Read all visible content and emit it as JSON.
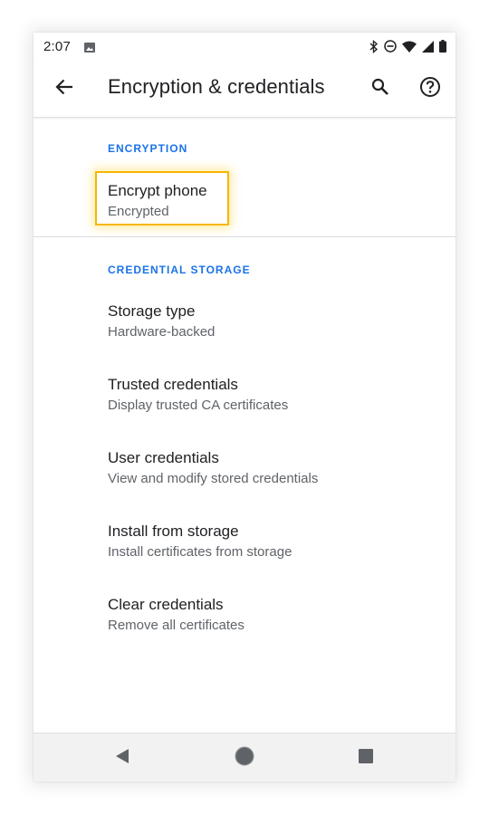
{
  "status_bar": {
    "time": "2:07",
    "icons": [
      "image-icon",
      "bluetooth-icon",
      "do-not-disturb-icon",
      "wifi-icon",
      "signal-icon",
      "battery-icon"
    ]
  },
  "app_bar": {
    "title": "Encryption & credentials",
    "back_icon": "arrow-back-icon",
    "search_icon": "search-icon",
    "help_icon": "help-icon"
  },
  "sections": [
    {
      "header": "ENCRYPTION",
      "items": [
        {
          "title": "Encrypt phone",
          "summary": "Encrypted"
        }
      ]
    },
    {
      "header": "CREDENTIAL STORAGE",
      "items": [
        {
          "title": "Storage type",
          "summary": "Hardware-backed"
        },
        {
          "title": "Trusted credentials",
          "summary": "Display trusted CA certificates"
        },
        {
          "title": "User credentials",
          "summary": "View and modify stored credentials"
        },
        {
          "title": "Install from storage",
          "summary": "Install certificates from storage"
        },
        {
          "title": "Clear credentials",
          "summary": "Remove all certificates"
        }
      ]
    }
  ],
  "nav_bar": {
    "icons": [
      "back-triangle-icon",
      "home-circle-icon",
      "recents-square-icon"
    ]
  },
  "colors": {
    "accent": "#1a73e8",
    "highlight": "#f6b700",
    "primary_text": "#202124",
    "secondary_text": "#5f6368"
  }
}
